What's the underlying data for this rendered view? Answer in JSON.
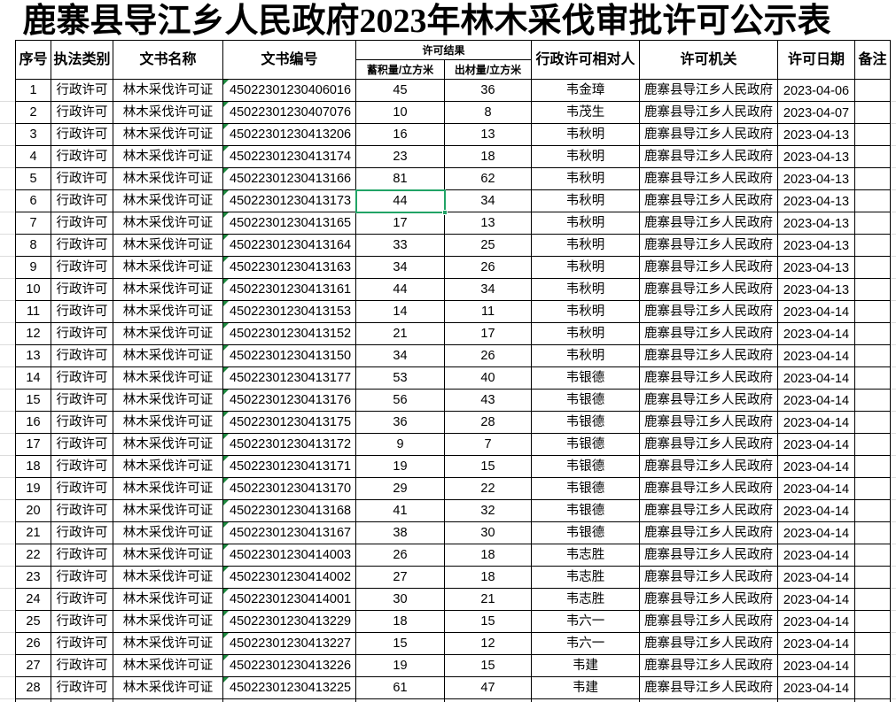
{
  "title": "鹿寨县导江乡人民政府2023年林木采伐审批许可公示表",
  "headers": {
    "seq": "序号",
    "category": "执法类别",
    "doc_name": "文书名称",
    "doc_no": "文书编号",
    "result": "许可结果",
    "volume": "蓄积量/立方米",
    "output": "出材量/立方米",
    "licensee": "行政许可相对人",
    "authority": "许可机关",
    "date": "许可日期",
    "remarks": "备注"
  },
  "rows": [
    {
      "seq": 1,
      "category": "行政许可",
      "doc_name": "林木采伐许可证",
      "doc_no": "45022301230406016",
      "volume": 45,
      "output": 36,
      "licensee": "韦金璋",
      "authority": "鹿寨县导江乡人民政府",
      "date": "2023-04-06"
    },
    {
      "seq": 2,
      "category": "行政许可",
      "doc_name": "林木采伐许可证",
      "doc_no": "45022301230407076",
      "volume": 10,
      "output": 8,
      "licensee": "韦茂生",
      "authority": "鹿寨县导江乡人民政府",
      "date": "2023-04-07"
    },
    {
      "seq": 3,
      "category": "行政许可",
      "doc_name": "林木采伐许可证",
      "doc_no": "45022301230413206",
      "volume": 16,
      "output": 13,
      "licensee": "韦秋明",
      "authority": "鹿寨县导江乡人民政府",
      "date": "2023-04-13"
    },
    {
      "seq": 4,
      "category": "行政许可",
      "doc_name": "林木采伐许可证",
      "doc_no": "45022301230413174",
      "volume": 23,
      "output": 18,
      "licensee": "韦秋明",
      "authority": "鹿寨县导江乡人民政府",
      "date": "2023-04-13"
    },
    {
      "seq": 5,
      "category": "行政许可",
      "doc_name": "林木采伐许可证",
      "doc_no": "45022301230413166",
      "volume": 81,
      "output": 62,
      "licensee": "韦秋明",
      "authority": "鹿寨县导江乡人民政府",
      "date": "2023-04-13"
    },
    {
      "seq": 6,
      "category": "行政许可",
      "doc_name": "林木采伐许可证",
      "doc_no": "45022301230413173",
      "volume": 44,
      "output": 34,
      "licensee": "韦秋明",
      "authority": "鹿寨县导江乡人民政府",
      "date": "2023-04-13"
    },
    {
      "seq": 7,
      "category": "行政许可",
      "doc_name": "林木采伐许可证",
      "doc_no": "45022301230413165",
      "volume": 17,
      "output": 13,
      "licensee": "韦秋明",
      "authority": "鹿寨县导江乡人民政府",
      "date": "2023-04-13"
    },
    {
      "seq": 8,
      "category": "行政许可",
      "doc_name": "林木采伐许可证",
      "doc_no": "45022301230413164",
      "volume": 33,
      "output": 25,
      "licensee": "韦秋明",
      "authority": "鹿寨县导江乡人民政府",
      "date": "2023-04-13"
    },
    {
      "seq": 9,
      "category": "行政许可",
      "doc_name": "林木采伐许可证",
      "doc_no": "45022301230413163",
      "volume": 34,
      "output": 26,
      "licensee": "韦秋明",
      "authority": "鹿寨县导江乡人民政府",
      "date": "2023-04-13"
    },
    {
      "seq": 10,
      "category": "行政许可",
      "doc_name": "林木采伐许可证",
      "doc_no": "45022301230413161",
      "volume": 44,
      "output": 34,
      "licensee": "韦秋明",
      "authority": "鹿寨县导江乡人民政府",
      "date": "2023-04-13"
    },
    {
      "seq": 11,
      "category": "行政许可",
      "doc_name": "林木采伐许可证",
      "doc_no": "45022301230413153",
      "volume": 14,
      "output": 11,
      "licensee": "韦秋明",
      "authority": "鹿寨县导江乡人民政府",
      "date": "2023-04-14"
    },
    {
      "seq": 12,
      "category": "行政许可",
      "doc_name": "林木采伐许可证",
      "doc_no": "45022301230413152",
      "volume": 21,
      "output": 17,
      "licensee": "韦秋明",
      "authority": "鹿寨县导江乡人民政府",
      "date": "2023-04-14"
    },
    {
      "seq": 13,
      "category": "行政许可",
      "doc_name": "林木采伐许可证",
      "doc_no": "45022301230413150",
      "volume": 34,
      "output": 26,
      "licensee": "韦秋明",
      "authority": "鹿寨县导江乡人民政府",
      "date": "2023-04-14"
    },
    {
      "seq": 14,
      "category": "行政许可",
      "doc_name": "林木采伐许可证",
      "doc_no": "45022301230413177",
      "volume": 53,
      "output": 40,
      "licensee": "韦银德",
      "authority": "鹿寨县导江乡人民政府",
      "date": "2023-04-14"
    },
    {
      "seq": 15,
      "category": "行政许可",
      "doc_name": "林木采伐许可证",
      "doc_no": "45022301230413176",
      "volume": 56,
      "output": 43,
      "licensee": "韦银德",
      "authority": "鹿寨县导江乡人民政府",
      "date": "2023-04-14"
    },
    {
      "seq": 16,
      "category": "行政许可",
      "doc_name": "林木采伐许可证",
      "doc_no": "45022301230413175",
      "volume": 36,
      "output": 28,
      "licensee": "韦银德",
      "authority": "鹿寨县导江乡人民政府",
      "date": "2023-04-14"
    },
    {
      "seq": 17,
      "category": "行政许可",
      "doc_name": "林木采伐许可证",
      "doc_no": "45022301230413172",
      "volume": 9,
      "output": 7,
      "licensee": "韦银德",
      "authority": "鹿寨县导江乡人民政府",
      "date": "2023-04-14"
    },
    {
      "seq": 18,
      "category": "行政许可",
      "doc_name": "林木采伐许可证",
      "doc_no": "45022301230413171",
      "volume": 19,
      "output": 15,
      "licensee": "韦银德",
      "authority": "鹿寨县导江乡人民政府",
      "date": "2023-04-14"
    },
    {
      "seq": 19,
      "category": "行政许可",
      "doc_name": "林木采伐许可证",
      "doc_no": "45022301230413170",
      "volume": 29,
      "output": 22,
      "licensee": "韦银德",
      "authority": "鹿寨县导江乡人民政府",
      "date": "2023-04-14"
    },
    {
      "seq": 20,
      "category": "行政许可",
      "doc_name": "林木采伐许可证",
      "doc_no": "45022301230413168",
      "volume": 41,
      "output": 32,
      "licensee": "韦银德",
      "authority": "鹿寨县导江乡人民政府",
      "date": "2023-04-14"
    },
    {
      "seq": 21,
      "category": "行政许可",
      "doc_name": "林木采伐许可证",
      "doc_no": "45022301230413167",
      "volume": 38,
      "output": 30,
      "licensee": "韦银德",
      "authority": "鹿寨县导江乡人民政府",
      "date": "2023-04-14"
    },
    {
      "seq": 22,
      "category": "行政许可",
      "doc_name": "林木采伐许可证",
      "doc_no": "45022301230414003",
      "volume": 26,
      "output": 18,
      "licensee": "韦志胜",
      "authority": "鹿寨县导江乡人民政府",
      "date": "2023-04-14"
    },
    {
      "seq": 23,
      "category": "行政许可",
      "doc_name": "林木采伐许可证",
      "doc_no": "45022301230414002",
      "volume": 27,
      "output": 18,
      "licensee": "韦志胜",
      "authority": "鹿寨县导江乡人民政府",
      "date": "2023-04-14"
    },
    {
      "seq": 24,
      "category": "行政许可",
      "doc_name": "林木采伐许可证",
      "doc_no": "45022301230414001",
      "volume": 30,
      "output": 21,
      "licensee": "韦志胜",
      "authority": "鹿寨县导江乡人民政府",
      "date": "2023-04-14"
    },
    {
      "seq": 25,
      "category": "行政许可",
      "doc_name": "林木采伐许可证",
      "doc_no": "45022301230413229",
      "volume": 18,
      "output": 15,
      "licensee": "韦六一",
      "authority": "鹿寨县导江乡人民政府",
      "date": "2023-04-14"
    },
    {
      "seq": 26,
      "category": "行政许可",
      "doc_name": "林木采伐许可证",
      "doc_no": "45022301230413227",
      "volume": 15,
      "output": 12,
      "licensee": "韦六一",
      "authority": "鹿寨县导江乡人民政府",
      "date": "2023-04-14"
    },
    {
      "seq": 27,
      "category": "行政许可",
      "doc_name": "林木采伐许可证",
      "doc_no": "45022301230413226",
      "volume": 19,
      "output": 15,
      "licensee": "韦建",
      "authority": "鹿寨县导江乡人民政府",
      "date": "2023-04-14"
    },
    {
      "seq": 28,
      "category": "行政许可",
      "doc_name": "林木采伐许可证",
      "doc_no": "45022301230413225",
      "volume": 61,
      "output": 47,
      "licensee": "韦建",
      "authority": "鹿寨县导江乡人民政府",
      "date": "2023-04-14"
    }
  ],
  "selected_cell": {
    "row": 6,
    "column": 5
  },
  "colors": {
    "selection": "#21a366",
    "text_number_flag": "#1d8a3f",
    "grid_line": "#000000"
  }
}
